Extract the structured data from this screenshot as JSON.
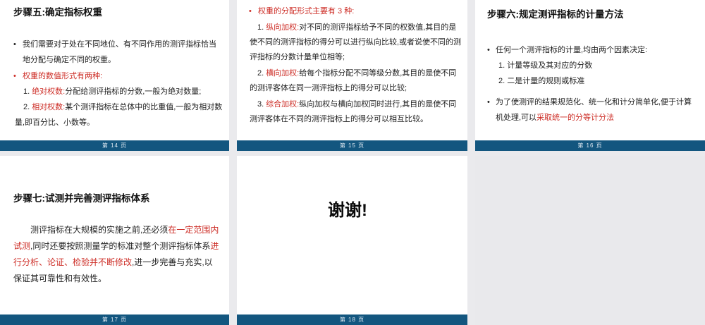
{
  "view": {
    "name": "presentation-page-preview-grid"
  },
  "colors": {
    "canvas_background": "#eaeaed",
    "slide_background": "#ffffff",
    "footer_bar": "#13567f",
    "footer_text": "#dde8f1",
    "highlight_red": "#cd2d26",
    "body_text": "#1f1f1f"
  },
  "glyphs": {
    "bullet": "•"
  },
  "slides": [
    {
      "page_label": "第 14 页",
      "title": "步骤五:确定指标权重",
      "bullet1": "我们需要对于处在不同地位、有不同作用的测评指标恰当地分配与确定不同的权重。",
      "lead_red": "权重的数值形式有两种:",
      "items": [
        {
          "num": "1.",
          "term": "绝对权数:",
          "text": "分配给测评指标的分数,一般为绝对数量;"
        },
        {
          "num": "2.",
          "term": "相对权数:",
          "text": "某个测评指标在总体中的比重值,一般为相对数量,即百分比、小数等。"
        }
      ]
    },
    {
      "page_label": "第 15 页",
      "lead_red": "权重的分配形式主要有 3 种:",
      "items": [
        {
          "num": "1.",
          "term": "纵向加权:",
          "text": "对不同的测评指标给予不同的权数值,其目的是使不同的测评指标的得分可以进行纵向比较,或者说使不同的测评指标的分数计量单位相等;"
        },
        {
          "num": "2.",
          "term": "横向加权:",
          "text": "给每个指标分配不同等级分数,其目的是使不同的测评客体在同一测评指标上的得分可以比较;"
        },
        {
          "num": "3.",
          "term": "综合加权:",
          "text": "纵向加权与横向加权同时进行,其目的是使不同测评客体在不同的测评指标上的得分可以相互比较。"
        }
      ]
    },
    {
      "page_label": "第 16 页",
      "title": "步骤六:规定测评指标的计量方法",
      "bullet1": "任何一个测评指标的计量,均由两个因素决定:",
      "subitems": [
        "1. 计量等级及其对应的分数",
        "2. 二是计量的规则或标准"
      ],
      "bullet2_black": "为了使测评的结果规范化、统一化和计分简单化,便于计算机处理,可以",
      "bullet2_red": "采取统一的分等计分法"
    },
    {
      "page_label": "第 17 页",
      "title": "步骤七:试测并完善测评指标体系",
      "para_parts": [
        {
          "text": "测评指标在大规模的实施之前,还必须"
        },
        {
          "text": "在一定范围内试测"
        },
        {
          "text": ",同时还要按照测量学的标准对整个测评指标体系"
        },
        {
          "text": "进行分析、论证、检验并不断修改"
        },
        {
          "text": ",进一步完善与充实,以保证其可靠性和有效性。"
        }
      ]
    },
    {
      "page_label": "第 18 页",
      "thanks": "谢谢!"
    }
  ]
}
